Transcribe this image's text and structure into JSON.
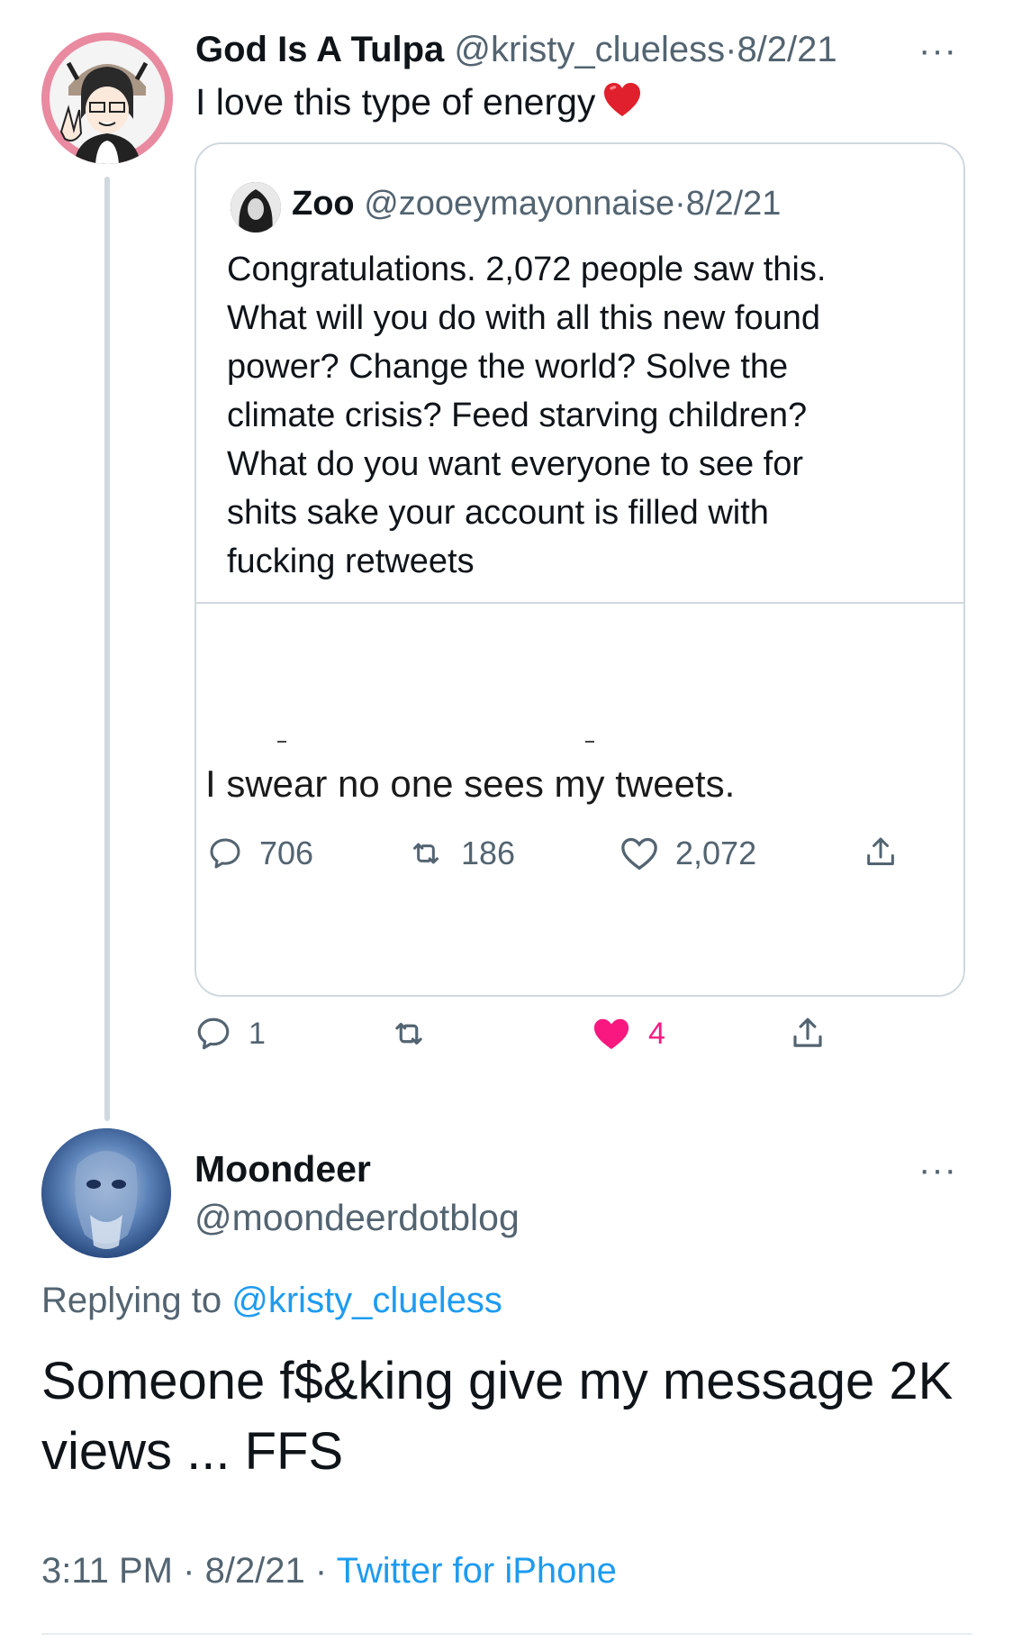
{
  "tweet1": {
    "name": "God Is A Tulpa",
    "handle": "@kristy_clueless",
    "separator": "·",
    "date": "8/2/21",
    "more": "···",
    "text": "I love this type of energy",
    "emoji": "heart-emoji",
    "actions": {
      "reply_count": "1",
      "retweet_count": "",
      "like_count": "4",
      "liked": true
    },
    "colors": {
      "like": "#f91880",
      "avatar_ring": "#e98aa0"
    }
  },
  "quote": {
    "name": "Zoo",
    "handle": "@zooeymayonnaise",
    "separator": "·",
    "date": "8/2/21",
    "lines": [
      "Congratulations. 2,072 people saw this.",
      "What will you do with all this new found",
      "power? Change the world? Solve the",
      "climate crisis? Feed starving children?",
      "What do you want everyone to see for",
      "shits sake your account is filled with",
      "fucking retweets"
    ],
    "media": {
      "caption": "I swear no one sees my tweets.",
      "reply_count": "706",
      "retweet_count": "186",
      "like_count": "2,072"
    }
  },
  "tweet2": {
    "name": "Moondeer",
    "handle": "@moondeerdotblog",
    "more": "···",
    "replying_prefix": "Replying to",
    "replying_to": "@kristy_clueless",
    "text": "Someone f$&king give my message 2K views ... FFS",
    "time": "3:11 PM",
    "separator1": "·",
    "date": "8/2/21",
    "separator2": "·",
    "source": "Twitter for iPhone"
  },
  "colors": {
    "link": "#1d9bf0",
    "muted": "#536471",
    "text": "#0f1419",
    "border": "#cfd9de"
  }
}
